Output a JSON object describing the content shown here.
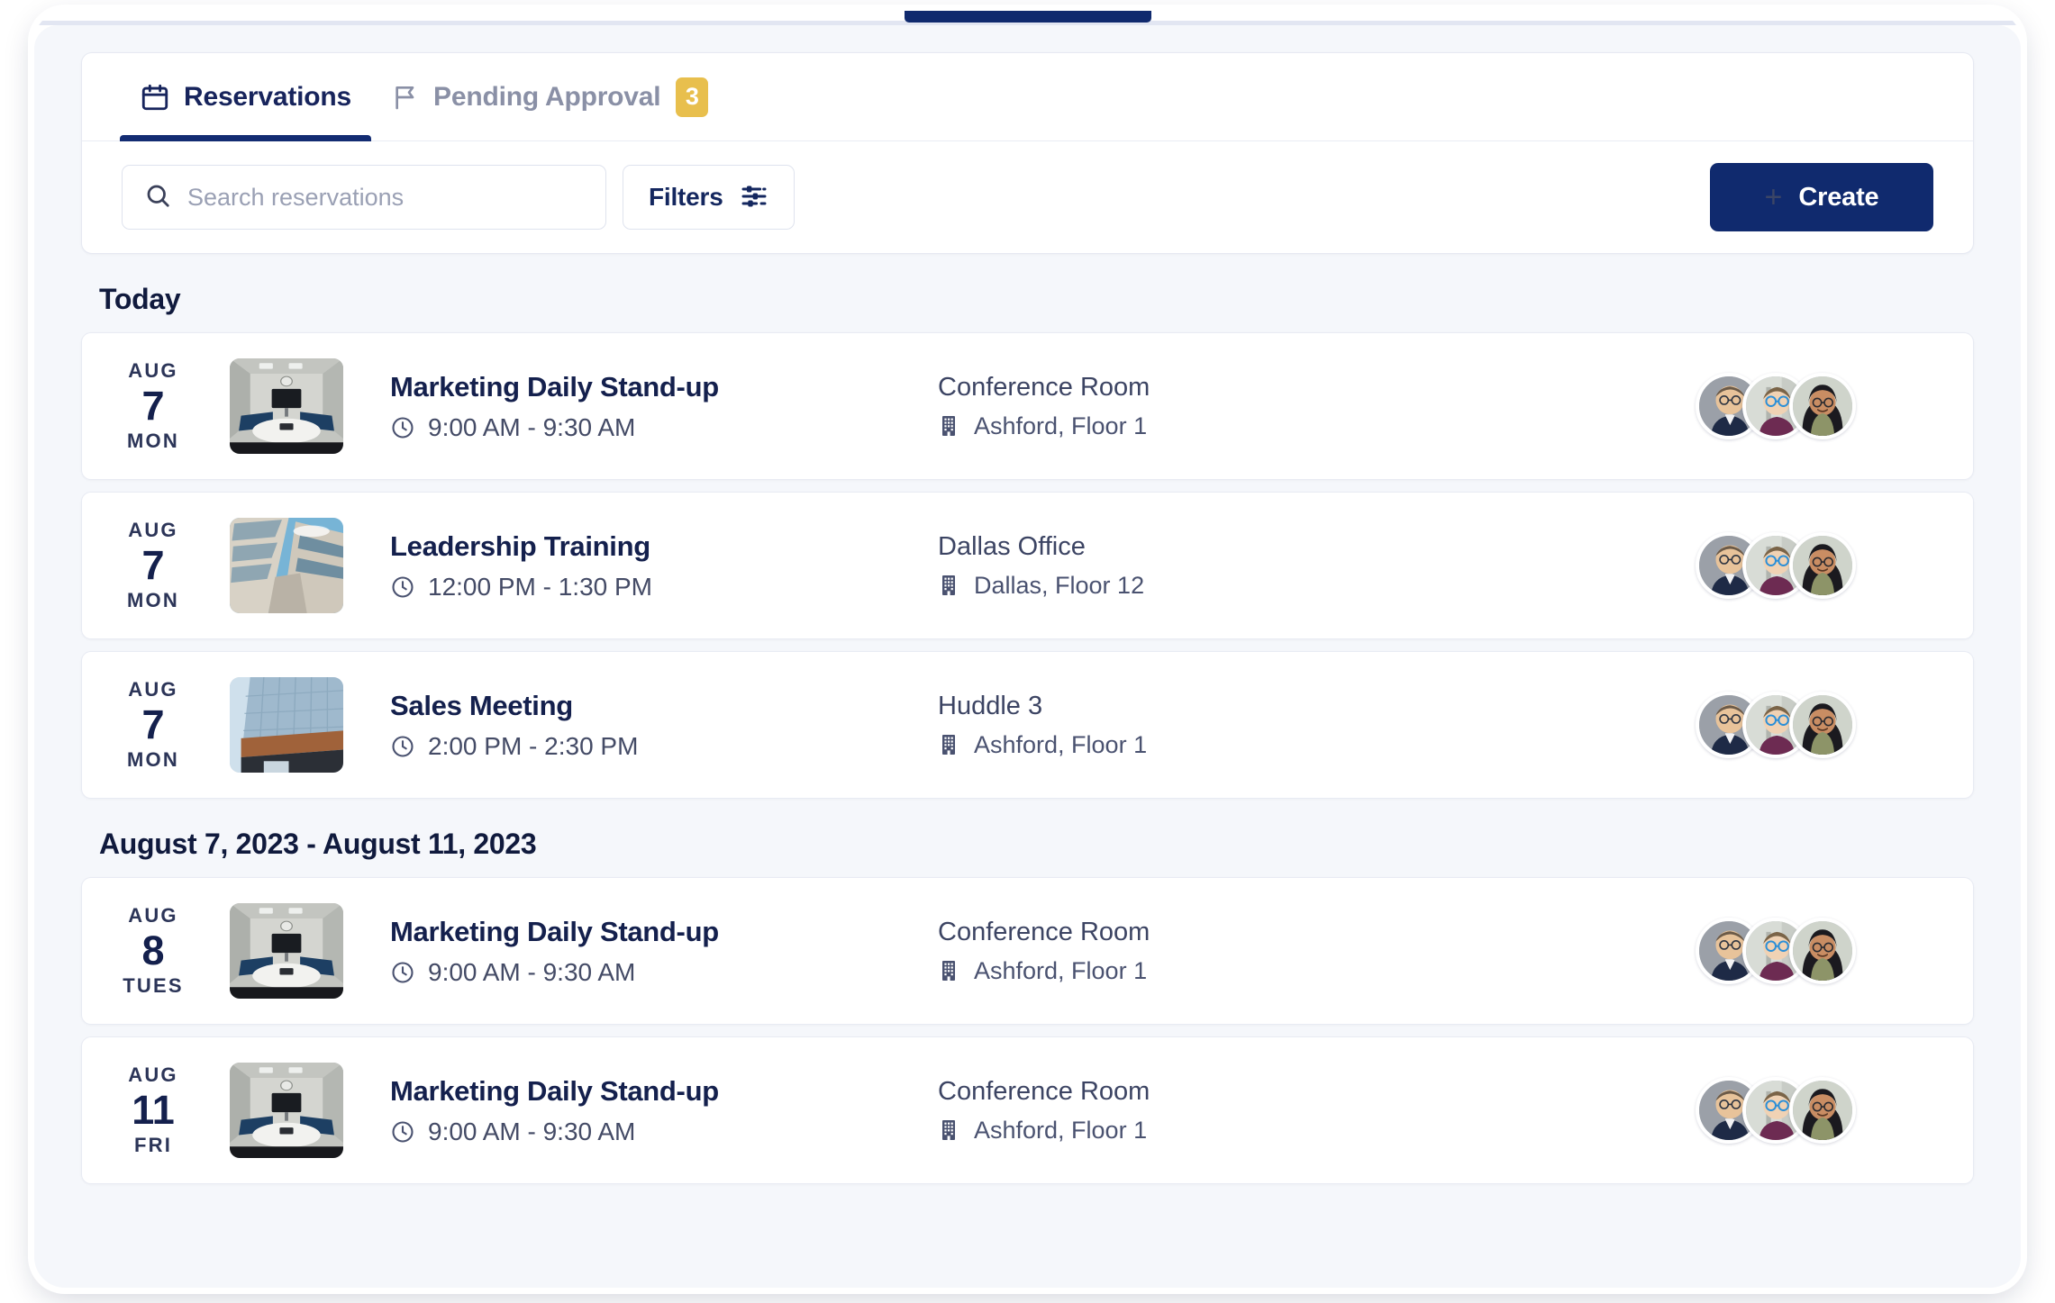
{
  "theme": {
    "brand_navy": "#102a6e",
    "badge_amber": "#e8bf4d",
    "surface_bg": "#f5f7fb",
    "card_bg": "#ffffff",
    "text_dark": "#14204d",
    "text_muted": "#8a90a6"
  },
  "tabs": [
    {
      "id": "reservations",
      "label": "Reservations",
      "icon": "calendar-icon",
      "active": true,
      "badge": null
    },
    {
      "id": "pending-approval",
      "label": "Pending Approval",
      "icon": "flag-icon",
      "active": false,
      "badge": "3"
    }
  ],
  "toolbar": {
    "search_placeholder": "Search reservations",
    "search_value": "",
    "search_icon": "search-icon",
    "filters_label": "Filters",
    "filters_icon": "sliders-icon",
    "create_label": "Create",
    "create_icon": "plus-icon"
  },
  "sections": [
    {
      "id": "today",
      "heading": "Today",
      "rows": [
        {
          "month": "AUG",
          "day": "7",
          "weekday": "MON",
          "thumb": "conference-room-photo",
          "title": "Marketing Daily Stand-up",
          "time": "9:00 AM - 9:30 AM",
          "room": "Conference Room",
          "location": "Ashford, Floor 1",
          "attendee_count": 3
        },
        {
          "month": "AUG",
          "day": "7",
          "weekday": "MON",
          "thumb": "office-building-upward-photo",
          "title": "Leadership Training",
          "time": "12:00 PM - 1:30 PM",
          "room": "Dallas Office",
          "location": "Dallas, Floor 12",
          "attendee_count": 3
        },
        {
          "month": "AUG",
          "day": "7",
          "weekday": "MON",
          "thumb": "glass-tower-photo",
          "title": "Sales Meeting",
          "time": "2:00 PM - 2:30 PM",
          "room": "Huddle 3",
          "location": "Ashford, Floor 1",
          "attendee_count": 3
        }
      ]
    },
    {
      "id": "week-range",
      "heading": "August 7, 2023 - August 11, 2023",
      "rows": [
        {
          "month": "AUG",
          "day": "8",
          "weekday": "TUES",
          "thumb": "conference-room-photo",
          "title": "Marketing Daily Stand-up",
          "time": "9:00 AM - 9:30 AM",
          "room": "Conference Room",
          "location": "Ashford, Floor 1",
          "attendee_count": 3
        },
        {
          "month": "AUG",
          "day": "11",
          "weekday": "FRI",
          "thumb": "conference-room-photo",
          "title": "Marketing Daily Stand-up",
          "time": "9:00 AM - 9:30 AM",
          "room": "Conference Room",
          "location": "Ashford, Floor 1",
          "attendee_count": 3
        }
      ]
    }
  ]
}
